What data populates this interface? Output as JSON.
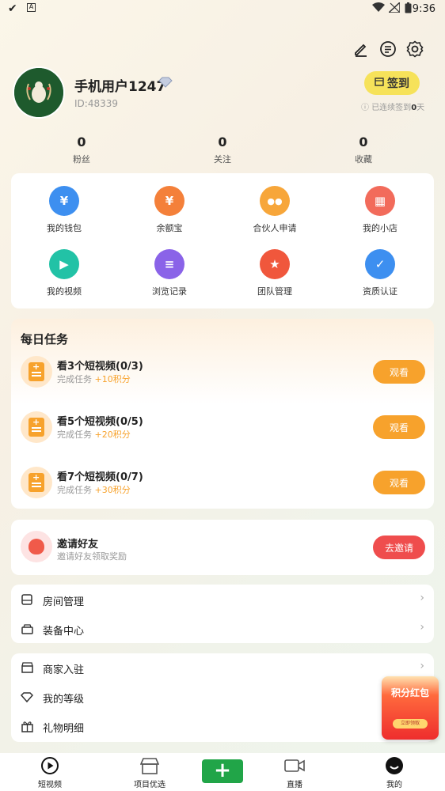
{
  "status_bar": {
    "time": "9:36",
    "left_icons": [
      "check-icon",
      "a-icon"
    ],
    "right_icons": [
      "wifi-icon",
      "signal-icon",
      "battery-icon"
    ]
  },
  "header": {
    "icons": [
      "edit-icon",
      "message-icon",
      "settings-icon"
    ]
  },
  "profile": {
    "name": "手机用户1247",
    "id": "ID:48339",
    "signin_label": "签到",
    "signin_note_prefix": "已连续签到",
    "signin_days": "0",
    "signin_note_suffix": "天"
  },
  "stats": [
    {
      "value": "0",
      "label": "粉丝"
    },
    {
      "value": "0",
      "label": "关注"
    },
    {
      "value": "0",
      "label": "收藏"
    }
  ],
  "features": [
    {
      "label": "我的钱包",
      "icon": "wallet-icon",
      "color": "#3d8ff0",
      "glyph": "¥"
    },
    {
      "label": "余额宝",
      "icon": "money-bag-icon",
      "color": "#f4803a",
      "glyph": "¥"
    },
    {
      "label": "合伙人申请",
      "icon": "partner-icon",
      "color": "#f7a63a",
      "glyph": "●●"
    },
    {
      "label": "我的小店",
      "icon": "shop-icon",
      "color": "#f26b5b",
      "glyph": "▦"
    },
    {
      "label": "我的视频",
      "icon": "video-icon",
      "color": "#22c2a6",
      "glyph": "▶"
    },
    {
      "label": "浏览记录",
      "icon": "history-icon",
      "color": "#8a63e8",
      "glyph": "≡"
    },
    {
      "label": "团队管理",
      "icon": "team-icon",
      "color": "#f0573c",
      "glyph": "★"
    },
    {
      "label": "资质认证",
      "icon": "certify-icon",
      "color": "#3d8ff0",
      "glyph": "✓"
    }
  ],
  "daily_tasks": {
    "title": "每日任务",
    "items": [
      {
        "name": "看3个短视频(0/3)",
        "sub": "完成任务",
        "points": "+10积分",
        "button": "观看"
      },
      {
        "name": "看5个短视频(0/5)",
        "sub": "完成任务",
        "points": "+20积分",
        "button": "观看"
      },
      {
        "name": "看7个短视频(0/7)",
        "sub": "完成任务",
        "points": "+30积分",
        "button": "观看"
      }
    ]
  },
  "invite": {
    "title": "邀请好友",
    "sub": "邀请好友领取奖励",
    "button": "去邀请"
  },
  "menu1": [
    {
      "label": "房间管理",
      "icon": "room-icon"
    },
    {
      "label": "装备中心",
      "icon": "equipment-icon"
    }
  ],
  "menu2": [
    {
      "label": "商家入驻",
      "icon": "merchant-icon"
    },
    {
      "label": "我的等级",
      "icon": "level-icon"
    },
    {
      "label": "礼物明细",
      "icon": "gift-icon"
    }
  ],
  "red_packet": {
    "title": "积分红包",
    "button": "立即领取"
  },
  "tabbar": [
    {
      "label": "短视频",
      "icon": "play-circle-icon"
    },
    {
      "label": "项目优选",
      "icon": "store-icon"
    },
    {
      "label": "",
      "icon": "plus-icon"
    },
    {
      "label": "直播",
      "icon": "camera-icon"
    },
    {
      "label": "我的",
      "icon": "profile-icon"
    }
  ],
  "colors": {
    "accent_orange": "#f7a22c",
    "signin_yellow": "#f6e25a",
    "invite_red": "#ef4d4d",
    "plus_green": "#21a548"
  }
}
